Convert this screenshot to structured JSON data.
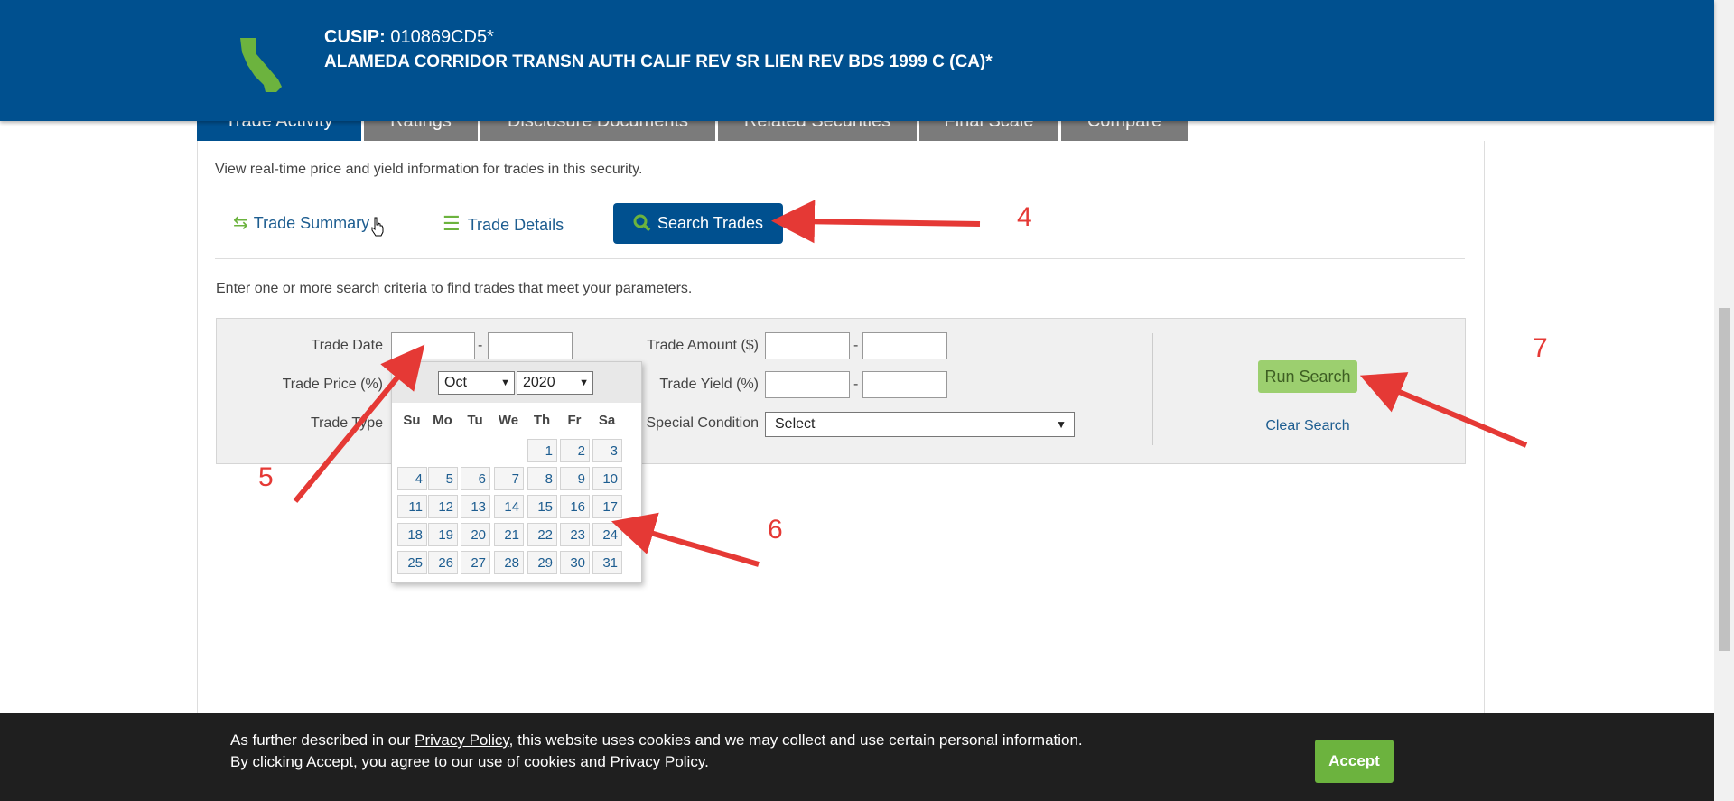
{
  "header": {
    "cusip_label": "CUSIP:",
    "cusip_value": "010869CD5*",
    "security_name": "ALAMEDA CORRIDOR TRANSN AUTH CALIF REV SR LIEN REV BDS 1999 C (CA)*",
    "state_icon": "california-state-icon",
    "bg_color": "#00508f"
  },
  "tabs": [
    {
      "label": "Trade Activity",
      "active": true
    },
    {
      "label": "Ratings",
      "active": false
    },
    {
      "label": "Disclosure Documents",
      "active": false
    },
    {
      "label": "Related Securities",
      "active": false
    },
    {
      "label": "Final Scale",
      "active": false
    },
    {
      "label": "Compare",
      "active": false
    }
  ],
  "panel": {
    "intro": "View real-time price and yield information for trades in this security.",
    "subtabs": {
      "summary": "Trade Summary",
      "details": "Trade Details",
      "search": "Search Trades"
    },
    "search_intro": "Enter one or more search criteria to find trades that meet your parameters."
  },
  "form": {
    "trade_date": "Trade Date",
    "trade_price": "Trade Price (%)",
    "trade_type": "Trade Type",
    "trade_amount": "Trade Amount ($)",
    "trade_yield": "Trade Yield (%)",
    "special_condition": "Special Condition",
    "special_condition_value": "Select",
    "dash": "-",
    "run_search": "Run Search",
    "clear_search": "Clear Search"
  },
  "datepicker": {
    "month": "Oct",
    "year": "2020",
    "weekdays": [
      "Su",
      "Mo",
      "Tu",
      "We",
      "Th",
      "Fr",
      "Sa"
    ],
    "days": [
      "1",
      "2",
      "3",
      "4",
      "5",
      "6",
      "7",
      "8",
      "9",
      "10",
      "11",
      "12",
      "13",
      "14",
      "15",
      "16",
      "17",
      "18",
      "19",
      "20",
      "21",
      "22",
      "23",
      "24",
      "25",
      "26",
      "27",
      "28",
      "29",
      "30",
      "31"
    ],
    "first_weekday_index": 4
  },
  "annotations": {
    "n4": "4",
    "n5": "5",
    "n6": "6",
    "n7": "7",
    "arrow_color": "#e53935"
  },
  "cookie": {
    "line1_pre": "As further described in our ",
    "line1_link": "Privacy Policy",
    "line1_post": ", this website uses cookies and we may collect and use certain personal information.",
    "line2_pre": "By clicking Accept, you agree to our use of cookies and ",
    "line2_link": "Privacy Policy",
    "line2_post": ".",
    "accept": "Accept"
  }
}
